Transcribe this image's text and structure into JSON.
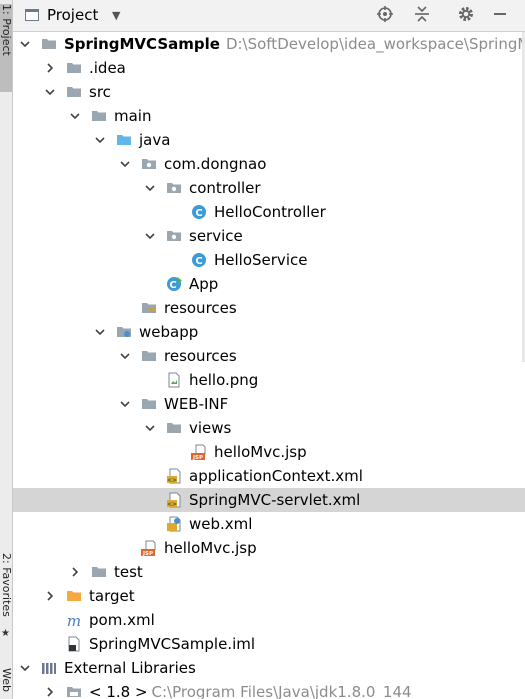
{
  "side": {
    "project_tab": "1: Project",
    "favorites_tab": "2: Favorites",
    "web_tab": "Web"
  },
  "header": {
    "title": "Project",
    "icons": [
      "project-view-icon",
      "locate-icon",
      "collapse-all-icon",
      "gear-icon",
      "minimize-icon"
    ]
  },
  "tree": [
    {
      "label": "SpringMVCSample",
      "path": "D:\\SoftDevelop\\idea_workspace\\SpringMV",
      "depth": 0,
      "arrow": "open",
      "icon": "module-folder",
      "bold": true
    },
    {
      "label": ".idea",
      "depth": 1,
      "arrow": "closed",
      "icon": "folder"
    },
    {
      "label": "src",
      "depth": 1,
      "arrow": "open",
      "icon": "folder"
    },
    {
      "label": "main",
      "depth": 2,
      "arrow": "open",
      "icon": "folder"
    },
    {
      "label": "java",
      "depth": 3,
      "arrow": "open",
      "icon": "source-folder"
    },
    {
      "label": "com.dongnao",
      "depth": 4,
      "arrow": "open",
      "icon": "package"
    },
    {
      "label": "controller",
      "depth": 5,
      "arrow": "open",
      "icon": "package"
    },
    {
      "label": "HelloController",
      "depth": 6,
      "arrow": "none",
      "icon": "java-class"
    },
    {
      "label": "service",
      "depth": 5,
      "arrow": "open",
      "icon": "package"
    },
    {
      "label": "HelloService",
      "depth": 6,
      "arrow": "none",
      "icon": "java-class"
    },
    {
      "label": "App",
      "depth": 5,
      "arrow": "none",
      "icon": "java-runnable-class"
    },
    {
      "label": "resources",
      "depth": 4,
      "arrow": "none",
      "icon": "resources-folder"
    },
    {
      "label": "webapp",
      "depth": 3,
      "arrow": "open",
      "icon": "web-folder"
    },
    {
      "label": "resources",
      "depth": 4,
      "arrow": "open",
      "icon": "folder"
    },
    {
      "label": "hello.png",
      "depth": 5,
      "arrow": "none",
      "icon": "image-file"
    },
    {
      "label": "WEB-INF",
      "depth": 4,
      "arrow": "open",
      "icon": "folder"
    },
    {
      "label": "views",
      "depth": 5,
      "arrow": "open",
      "icon": "folder"
    },
    {
      "label": "helloMvc.jsp",
      "depth": 6,
      "arrow": "none",
      "icon": "jsp-file"
    },
    {
      "label": "applicationContext.xml",
      "depth": 5,
      "arrow": "none",
      "icon": "spring-xml-file"
    },
    {
      "label": "SpringMVC-servlet.xml",
      "depth": 5,
      "arrow": "none",
      "icon": "spring-xml-file",
      "selected": true
    },
    {
      "label": "web.xml",
      "depth": 5,
      "arrow": "none",
      "icon": "web-xml-file"
    },
    {
      "label": "helloMvc.jsp",
      "depth": 4,
      "arrow": "none",
      "icon": "jsp-file"
    },
    {
      "label": "test",
      "depth": 2,
      "arrow": "closed",
      "icon": "folder"
    },
    {
      "label": "target",
      "depth": 1,
      "arrow": "closed",
      "icon": "excluded-folder"
    },
    {
      "label": "pom.xml",
      "depth": 1,
      "arrow": "none",
      "icon": "maven-file"
    },
    {
      "label": "SpringMVCSample.iml",
      "depth": 1,
      "arrow": "none",
      "icon": "iml-file"
    },
    {
      "label": "External Libraries",
      "depth": 0,
      "arrow": "open",
      "icon": "libraries"
    },
    {
      "label": "< 1.8 >",
      "path": "C:\\Program Files\\Java\\jdk1.8.0_144",
      "depth": 1,
      "arrow": "closed",
      "icon": "jdk"
    }
  ],
  "colors": {
    "selection": "#d5d5d5",
    "folder": "#9aa7b0",
    "source_folder": "#5fb8e8",
    "class_blue": "#3d9bd8",
    "excluded_orange": "#f5a742",
    "path_gray": "#8c8c8c"
  }
}
